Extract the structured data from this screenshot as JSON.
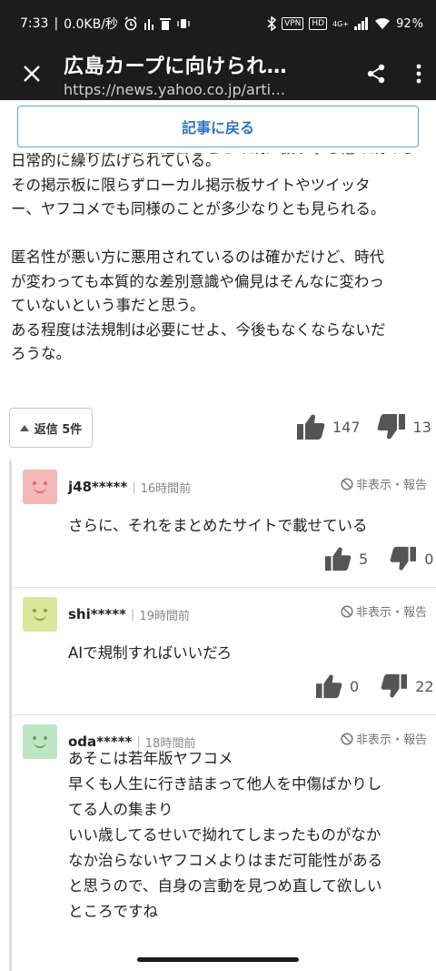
{
  "status_bar": {
    "time": "7:33",
    "speed": "0.0KB/秒",
    "vpn": "VPN",
    "hd": "HD",
    "net": "4G+",
    "battery": "92"
  },
  "app_bar": {
    "title": "広島カープに向けられ…",
    "url": "https://news.yahoo.co.jp/arti…"
  },
  "back_button": {
    "label": "記事に戻る"
  },
  "comment": {
    "lines": [
      "日常的に繰り広げられている。",
      "その掲示板に限らずローカル掲示板サイトやツイッタ",
      "ー、ヤフコメでも同様のことが多少なりとも見られる。",
      "",
      "匿名性が悪い方に悪用されているのは確かだけど、時代",
      "が変わっても本質的な差別意識や偏見はそんなに変わっ",
      "ていないという事だと思う。",
      "ある程度は法規制は必要にせよ、今後もなくならないだ",
      "ろうな。"
    ],
    "reply_count_label": "返信 5件",
    "likes": "147",
    "dislikes": "13"
  },
  "replies": [
    {
      "username": "j48*****",
      "time": "16時間前",
      "report": "非表示・報告",
      "avatar_color": "#f3b9b9",
      "face_color": "#d86b6b",
      "body": [
        "さらに、それをまとめたサイトで載せている"
      ],
      "likes": "5",
      "dislikes": "0"
    },
    {
      "username": "shi*****",
      "time": "19時間前",
      "report": "非表示・報告",
      "avatar_color": "#dbe79a",
      "face_color": "#8fa23a",
      "body": [
        "AIで規制すればいいだろ"
      ],
      "likes": "0",
      "dislikes": "22"
    },
    {
      "username": "oda*****",
      "time": "18時間前",
      "report": "非表示・報告",
      "avatar_color": "#bfe6c4",
      "face_color": "#5daa68",
      "body": [
        "あそこは若年版ヤフコメ",
        "早くも人生に行き詰まって他人を中傷ばかりし",
        "てる人の集まり",
        "いい歳してるせいで拗れてしまったものがなか",
        "なか治らないヤフコメよりはまだ可能性がある",
        "と思うので、自身の言動を見つめ直して欲しい",
        "ところですね"
      ]
    }
  ],
  "colors": {
    "bar_bg": "#1c1c1c",
    "accent_blue": "#2f76c2",
    "vote_gray": "#555555"
  }
}
